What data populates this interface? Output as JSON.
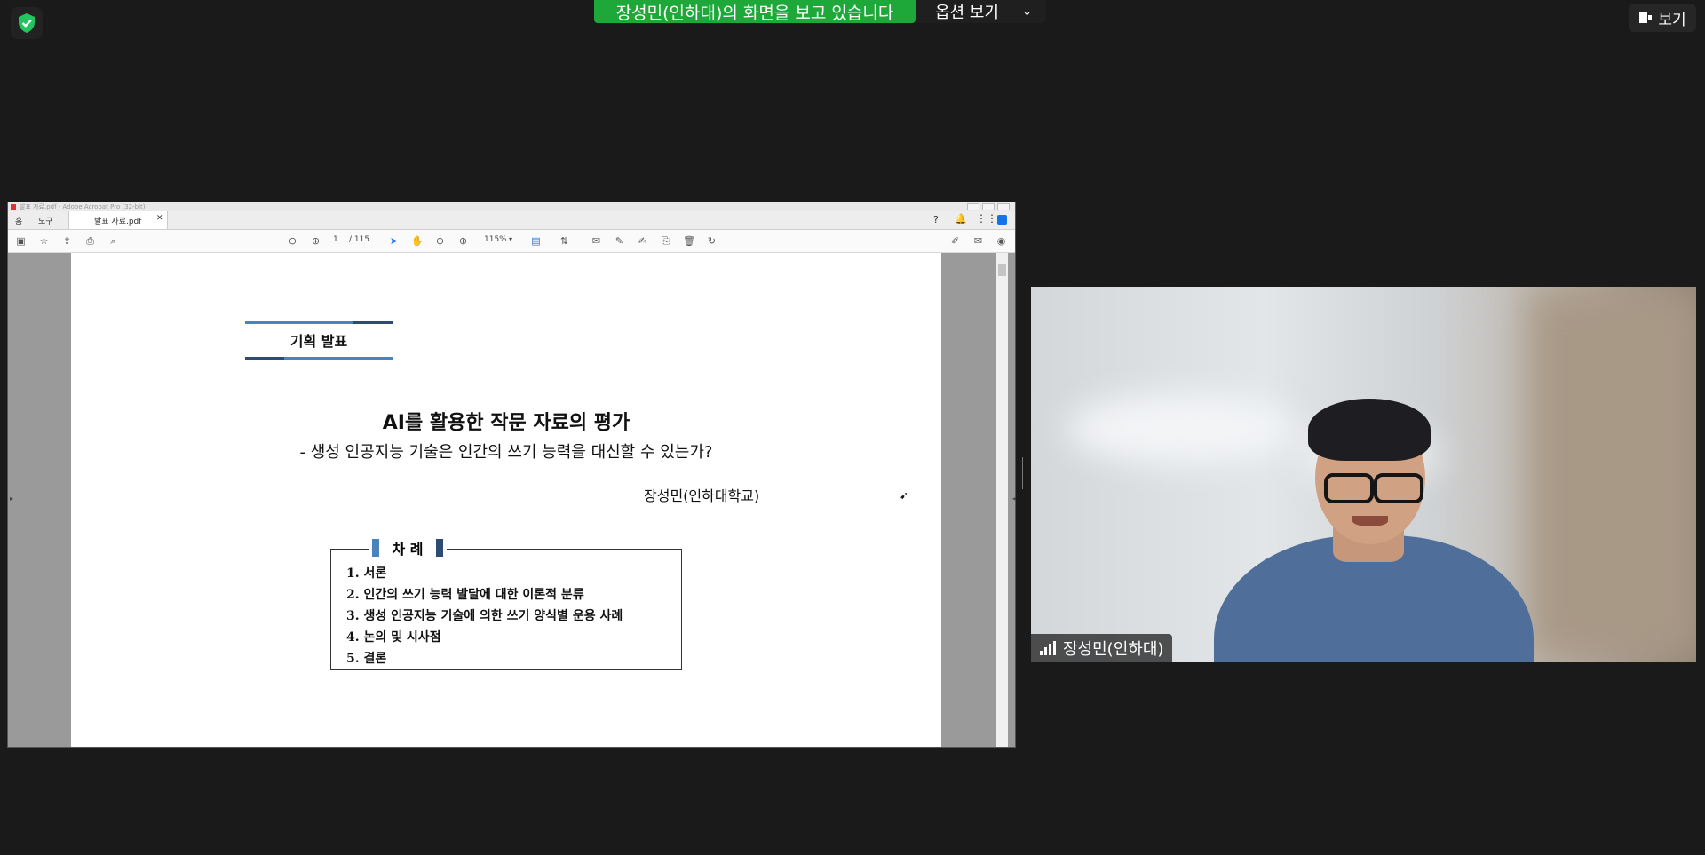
{
  "topbar": {
    "banner_text": "장성민(인하대)의 화면을 보고 있습니다",
    "options_label": "옵션 보기",
    "view_label": "보기"
  },
  "acrobat": {
    "window_title": "발표 자료.pdf - Adobe Acrobat Pro (32-bit)",
    "nav_home": "홈",
    "nav_tools": "도구",
    "tab_label": "발표 자료.pdf",
    "page_current": "1",
    "page_total": "/ 115",
    "zoom": "115%"
  },
  "document": {
    "plan_label": "기획 발표",
    "main_title": "AI를 활용한 작문 자료의 평가",
    "sub_title": "- 생성 인공지능 기술은 인간의 쓰기 능력을 대신할 수 있는가?",
    "author": "장성민(인하대학교)",
    "toc_heading": "차 례",
    "toc_items": [
      "1. 서론",
      "2. 인간의 쓰기 능력 발달에 대한 이론적 분류",
      "3. 생성 인공지능 기술에 의한 쓰기 양식별 운용 사례",
      "4. 논의 및 시사점",
      "5. 결론"
    ]
  },
  "video": {
    "participant_name": "장성민(인하대)"
  },
  "colors": {
    "banner_green": "#1fa83a",
    "heading_bar_dark": "#2e4b72",
    "heading_bar_light": "#4b83bd"
  }
}
